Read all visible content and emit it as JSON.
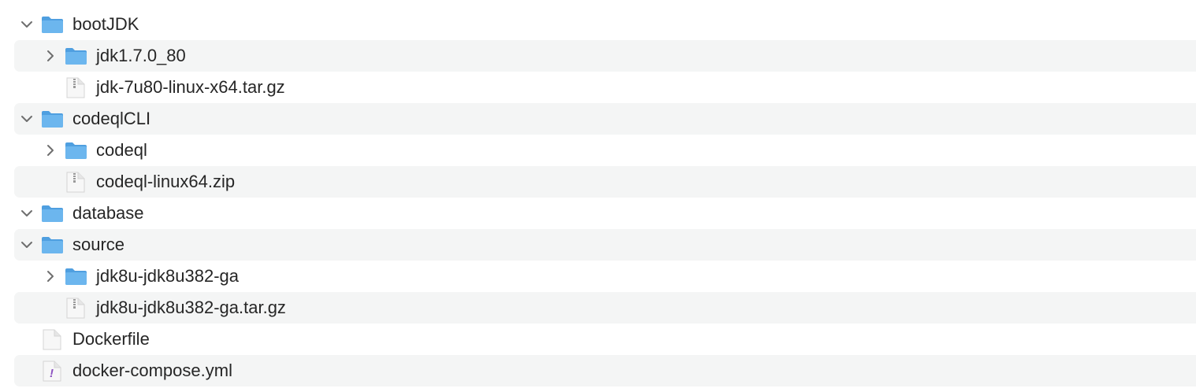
{
  "items": [
    {
      "name": "bootJDK",
      "type": "folder",
      "level": 0,
      "expanded": true
    },
    {
      "name": "jdk1.7.0_80",
      "type": "folder",
      "level": 1,
      "expanded": false
    },
    {
      "name": "jdk-7u80-linux-x64.tar.gz",
      "type": "archive",
      "level": 1
    },
    {
      "name": "codeqlCLI",
      "type": "folder",
      "level": 0,
      "expanded": true
    },
    {
      "name": "codeql",
      "type": "folder",
      "level": 1,
      "expanded": false
    },
    {
      "name": "codeql-linux64.zip",
      "type": "archive",
      "level": 1
    },
    {
      "name": "database",
      "type": "folder",
      "level": 0,
      "expanded": true
    },
    {
      "name": "source",
      "type": "folder",
      "level": 0,
      "expanded": true
    },
    {
      "name": "jdk8u-jdk8u382-ga",
      "type": "folder",
      "level": 1,
      "expanded": false
    },
    {
      "name": "jdk8u-jdk8u382-ga.tar.gz",
      "type": "archive",
      "level": 1
    },
    {
      "name": "Dockerfile",
      "type": "file",
      "level": 0
    },
    {
      "name": "docker-compose.yml",
      "type": "yaml",
      "level": 0
    }
  ],
  "colors": {
    "folder": "#6cb6ee",
    "alt_row": "#f4f5f5",
    "text": "#262626",
    "yaml_mark": "#8a4fc0"
  }
}
